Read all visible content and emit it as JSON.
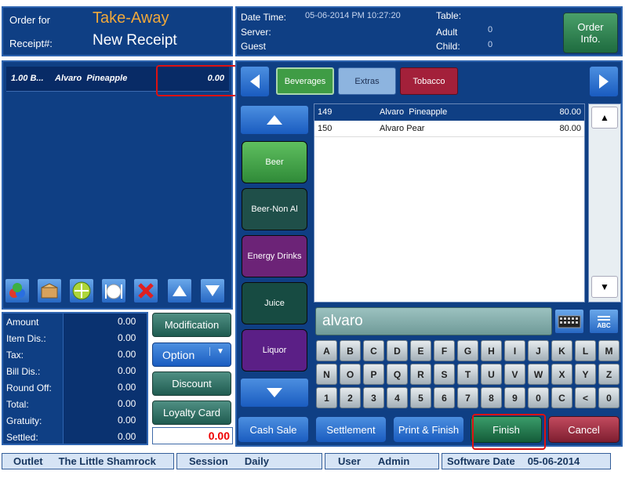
{
  "order": {
    "order_for_label": "Order for",
    "order_for_value": "Take-Away",
    "receipt_label": "Receipt#:",
    "receipt_value": "New Receipt"
  },
  "info": {
    "datetime_label": "Date Time:",
    "datetime_value": "05-06-2014 PM 10:27:20",
    "server_label": "Server:",
    "guest_label": "Guest",
    "table_label": "Table:",
    "adult_label": "Adult",
    "adult_value": "0",
    "child_label": "Child:",
    "child_value": "0",
    "order_info_button": "Order\nInfo."
  },
  "order_lines": [
    {
      "qty": "1.00 B...",
      "item": "Alvaro  Pineapple",
      "amount": "0.00"
    }
  ],
  "tabs": [
    {
      "label": "Beverages",
      "color": "#3f9c45"
    },
    {
      "label": "Extras",
      "color": "#8db4df"
    },
    {
      "label": "Tobacco",
      "color": "#a3203a"
    }
  ],
  "categories": [
    {
      "label": "Beer",
      "color": "#43a04a"
    },
    {
      "label": "Beer-Non Al",
      "color": "#1f4f49"
    },
    {
      "label": "Energy Drinks",
      "color": "#6c2377"
    },
    {
      "label": "Juice",
      "color": "#174b42"
    },
    {
      "label": "Liquor",
      "color": "#5b1f86"
    }
  ],
  "products": [
    {
      "code": "149",
      "name": "Alvaro  Pineapple",
      "price": "80.00"
    },
    {
      "code": "150",
      "name": "Alvaro Pear",
      "price": "80.00"
    }
  ],
  "search": {
    "value": "alvaro"
  },
  "keyboard": {
    "row1": [
      "A",
      "B",
      "C",
      "D",
      "E",
      "F",
      "G",
      "H",
      "I",
      "J",
      "K",
      "L",
      "M"
    ],
    "row2": [
      "N",
      "O",
      "P",
      "Q",
      "R",
      "S",
      "T",
      "U",
      "V",
      "W",
      "X",
      "Y",
      "Z"
    ],
    "row3": [
      "1",
      "2",
      "3",
      "4",
      "5",
      "6",
      "7",
      "8",
      "9",
      "0",
      "C",
      "<",
      "0"
    ]
  },
  "abc_label": "ABC",
  "totals": [
    {
      "label": "Amount",
      "value": "0.00"
    },
    {
      "label": "Item Dis.:",
      "value": "0.00"
    },
    {
      "label": "Tax:",
      "value": "0.00"
    },
    {
      "label": "Bill Dis.:",
      "value": "0.00"
    },
    {
      "label": "Round Off:",
      "value": "0.00"
    },
    {
      "label": "Total:",
      "value": "0.00"
    },
    {
      "label": "Gratuity:",
      "value": "0.00"
    },
    {
      "label": "Settled:",
      "value": "0.00"
    }
  ],
  "side_buttons": {
    "modification": "Modification",
    "option": "Option",
    "discount": "Discount",
    "loyalty": "Loyalty Card",
    "balance": "0.00"
  },
  "actions": {
    "cash_sale": "Cash Sale",
    "settlement": "Settlement",
    "print_finish": "Print & Finish",
    "finish": "Finish",
    "cancel": "Cancel"
  },
  "status": {
    "outlet_label": "Outlet",
    "outlet_value": "The Little Shamrock",
    "session_label": "Session",
    "session_value": "Daily",
    "user_label": "User",
    "user_value": "Admin",
    "date_label": "Software Date",
    "date_value": "05-06-2014"
  }
}
